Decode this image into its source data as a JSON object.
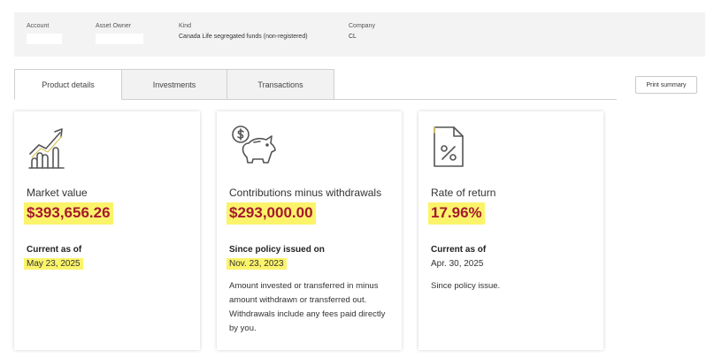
{
  "header": {
    "account_label": "Account",
    "asset_owner_label": "Asset Owner",
    "kind_label": "Kind",
    "kind_value": "Canada Life segregated funds (non-registered)",
    "company_label": "Company",
    "company_value": "CL"
  },
  "tabs": [
    "Product details",
    "Investments",
    "Transactions"
  ],
  "print_button": "Print summary",
  "cards": {
    "market": {
      "title": "Market value",
      "value": "$393,656.26",
      "sub_label": "Current as of",
      "sub_value": "May 23, 2025"
    },
    "contrib": {
      "title": "Contributions minus withdrawals",
      "value": "$293,000.00",
      "sub_label": "Since policy issued on",
      "sub_value": "Nov. 23, 2023",
      "note": "Amount invested or transferred in minus amount withdrawn or transferred out. Withdrawals include any fees paid directly by you."
    },
    "rate": {
      "title": "Rate of return",
      "value": "17.96%",
      "sub_label": "Current as of",
      "sub_value": "Apr. 30, 2025",
      "note": "Since policy issue."
    }
  },
  "colors": {
    "accent": "#a6192e",
    "highlight": "#fbf46b"
  }
}
